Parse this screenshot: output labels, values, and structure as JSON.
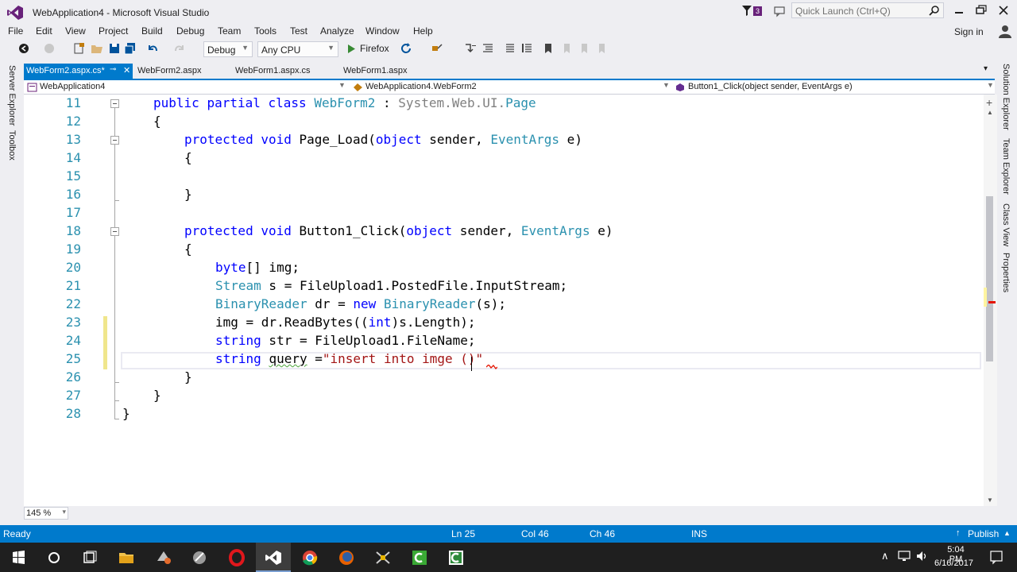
{
  "window": {
    "title": "WebApplication4 - Microsoft Visual Studio",
    "notification_count": "3",
    "quick_launch_placeholder": "Quick Launch (Ctrl+Q)",
    "sign_in": "Sign in"
  },
  "menu": [
    "File",
    "Edit",
    "View",
    "Project",
    "Build",
    "Debug",
    "Team",
    "Tools",
    "Test",
    "Analyze",
    "Window",
    "Help"
  ],
  "toolbar": {
    "configuration": "Debug",
    "platform": "Any CPU",
    "run_target": "Firefox"
  },
  "left_tool_windows": [
    "Server Explorer",
    "Toolbox"
  ],
  "right_tool_windows": [
    "Solution Explorer",
    "Team Explorer",
    "Class View",
    "Properties"
  ],
  "tabs": [
    {
      "label": "WebForm2.aspx.cs*",
      "active": true,
      "pinned": true
    },
    {
      "label": "WebForm2.aspx",
      "active": false
    },
    {
      "label": "WebForm1.aspx.cs",
      "active": false
    },
    {
      "label": "WebForm1.aspx",
      "active": false
    }
  ],
  "navigation": {
    "project": "WebApplication4",
    "type": "WebApplication4.WebForm2",
    "member": "Button1_Click(object sender, EventArgs e)"
  },
  "editor": {
    "lines": [
      {
        "n": "11",
        "code": "public partial class WebForm2 : System.Web.UI.Page"
      },
      {
        "n": "12",
        "code": "{"
      },
      {
        "n": "13",
        "code": "protected void Page_Load(object sender, EventArgs e)"
      },
      {
        "n": "14",
        "code": "{"
      },
      {
        "n": "15",
        "code": ""
      },
      {
        "n": "16",
        "code": "}"
      },
      {
        "n": "17",
        "code": ""
      },
      {
        "n": "18",
        "code": "protected void Button1_Click(object sender, EventArgs e)"
      },
      {
        "n": "19",
        "code": "{"
      },
      {
        "n": "20",
        "code": "byte[] img;"
      },
      {
        "n": "21",
        "code": "Stream s = FileUpload1.PostedFile.InputStream;"
      },
      {
        "n": "22",
        "code": "BinaryReader dr = new BinaryReader(s);"
      },
      {
        "n": "23",
        "code": "img = dr.ReadBytes((int)s.Length);"
      },
      {
        "n": "24",
        "code": "string str = FileUpload1.FileName;"
      },
      {
        "n": "25",
        "code": "string query =\"insert into imge ()\""
      },
      {
        "n": "26",
        "code": "}"
      },
      {
        "n": "27",
        "code": "}"
      },
      {
        "n": "28",
        "code": "}"
      }
    ],
    "zoom": "145 %"
  },
  "status": {
    "state": "Ready",
    "line": "Ln 25",
    "col": "Col 46",
    "ch": "Ch 46",
    "mode": "INS",
    "publish": "Publish"
  },
  "taskbar": {
    "time": "5:04 PM",
    "date": "6/16/2017"
  },
  "colors": {
    "accent": "#007acc",
    "keyword": "#0000ff",
    "type": "#2b91af",
    "string": "#a31515",
    "line_number": "#2b91af"
  }
}
